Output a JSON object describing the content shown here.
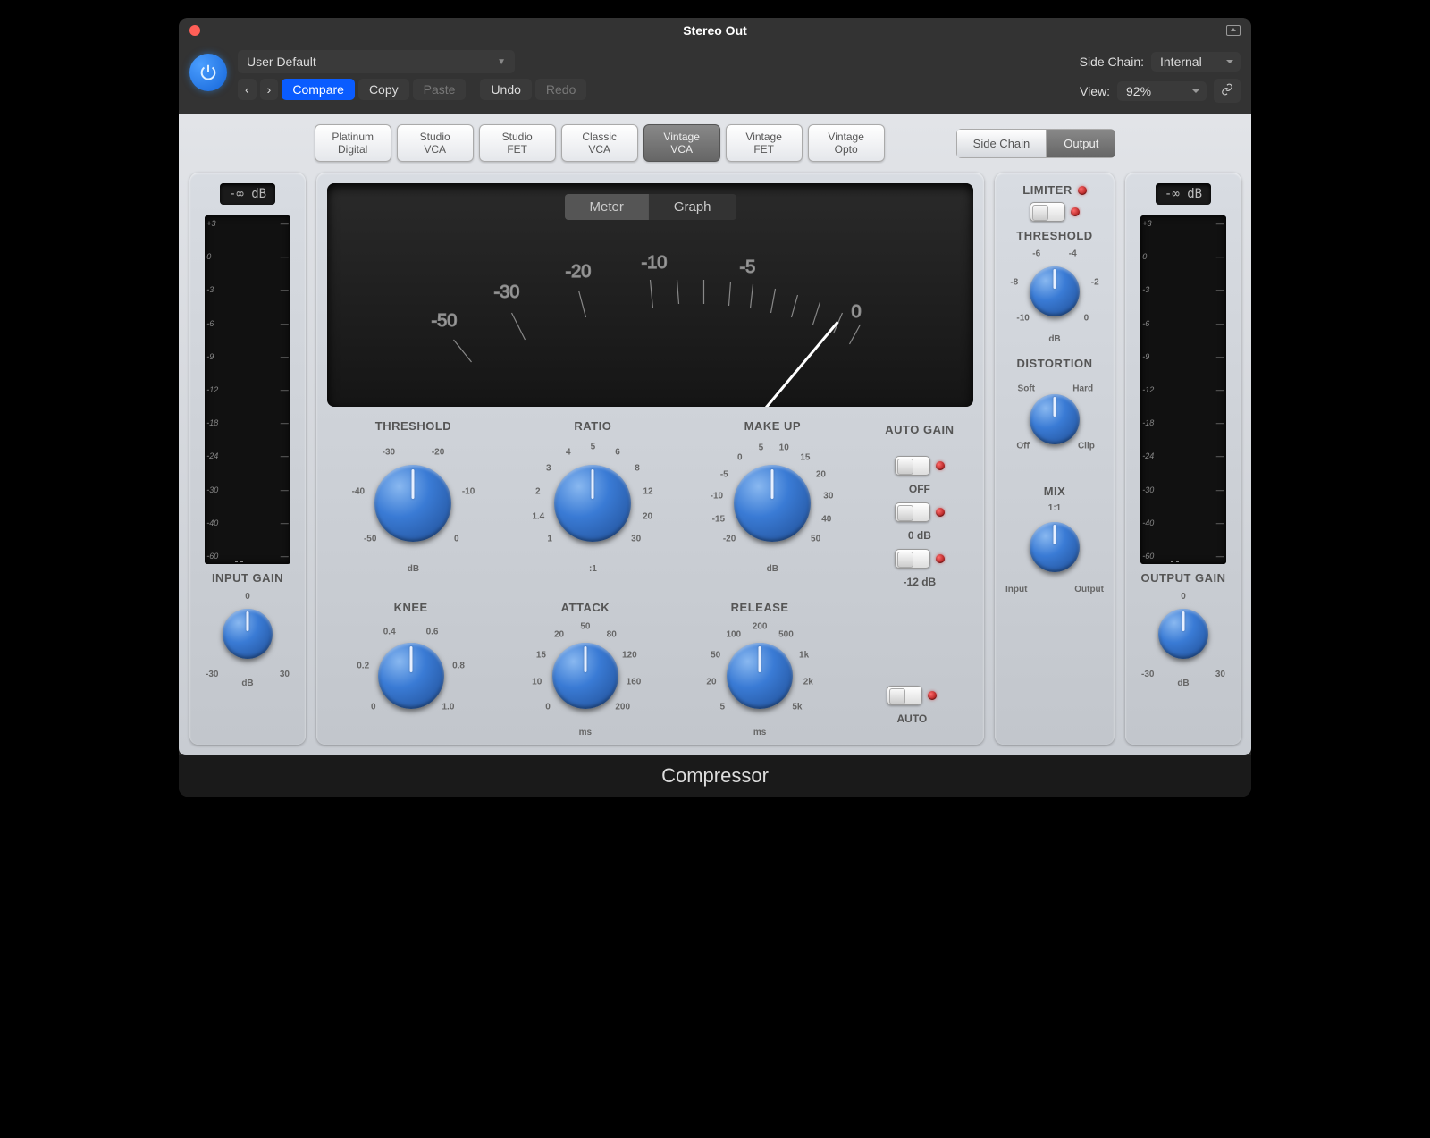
{
  "title": "Stereo Out",
  "preset": "User Default",
  "toolbar": {
    "compare": "Compare",
    "copy": "Copy",
    "paste": "Paste",
    "undo": "Undo",
    "redo": "Redo",
    "sidechain_label": "Side Chain:",
    "sidechain_value": "Internal",
    "view_label": "View:",
    "view_value": "92%"
  },
  "models": [
    {
      "l1": "Platinum",
      "l2": "Digital"
    },
    {
      "l1": "Studio",
      "l2": "VCA"
    },
    {
      "l1": "Studio",
      "l2": "FET"
    },
    {
      "l1": "Classic",
      "l2": "VCA"
    },
    {
      "l1": "Vintage",
      "l2": "VCA",
      "active": true
    },
    {
      "l1": "Vintage",
      "l2": "FET"
    },
    {
      "l1": "Vintage",
      "l2": "Opto"
    }
  ],
  "mode_toggle": {
    "sidechain": "Side Chain",
    "output": "Output"
  },
  "meter_toggle": {
    "meter": "Meter",
    "graph": "Graph"
  },
  "input": {
    "lcd": "-∞ dB",
    "label": "INPUT GAIN",
    "ticks": [
      "+3",
      "0",
      "-3",
      "-6",
      "-9",
      "-12",
      "-18",
      "-24",
      "-30",
      "-40",
      "-60"
    ],
    "knob": {
      "center": "0",
      "left": "-30",
      "right": "30",
      "unit": "dB",
      "angle": 0
    }
  },
  "output": {
    "lcd": "-∞ dB",
    "label": "OUTPUT GAIN",
    "ticks": [
      "+3",
      "0",
      "-3",
      "-6",
      "-9",
      "-12",
      "-18",
      "-24",
      "-30",
      "-40",
      "-60"
    ],
    "knob": {
      "center": "0",
      "left": "-30",
      "right": "30",
      "unit": "dB",
      "angle": 0
    }
  },
  "vu_scale": [
    "-50",
    "-30",
    "-20",
    "-10",
    "-5",
    "0"
  ],
  "knobs": {
    "threshold": {
      "label": "THRESHOLD",
      "labels": [
        "-50",
        "-40",
        "-30",
        "-20",
        "-10",
        "0"
      ],
      "unit": "dB",
      "angle": -50
    },
    "ratio": {
      "label": "RATIO",
      "labels": [
        "1",
        "1.4",
        "2",
        "3",
        "4",
        "5",
        "6",
        "8",
        "12",
        "20",
        "30"
      ],
      "unit": ":1",
      "angle": -90
    },
    "makeup": {
      "label": "MAKE UP",
      "labels": [
        "-20",
        "-15",
        "-10",
        "-5",
        "0",
        "5",
        "10",
        "15",
        "20",
        "30",
        "40",
        "50"
      ],
      "unit": "dB",
      "angle": -30
    },
    "knee": {
      "label": "KNEE",
      "labels": [
        "0",
        "0.2",
        "0.4",
        "0.6",
        "0.8",
        "1.0"
      ],
      "angle": 0
    },
    "attack": {
      "label": "ATTACK",
      "labels": [
        "0",
        "10",
        "15",
        "20",
        "50",
        "80",
        "120",
        "160",
        "200"
      ],
      "unit": "ms",
      "angle": -100
    },
    "release": {
      "label": "RELEASE",
      "labels": [
        "5",
        "20",
        "50",
        "100",
        "200",
        "500",
        "1k",
        "2k",
        "5k"
      ],
      "unit": "ms",
      "angle": -70
    }
  },
  "autogain": {
    "label": "AUTO GAIN",
    "off": "OFF",
    "zero": "0 dB",
    "neg12": "-12 dB",
    "auto": "AUTO"
  },
  "limiter": {
    "label": "LIMITER",
    "threshold": {
      "label": "THRESHOLD",
      "labels": [
        "-10",
        "-8",
        "-6",
        "-4",
        "-2",
        "0"
      ],
      "unit": "dB",
      "angle": 60
    },
    "distortion": {
      "label": "DISTORTION",
      "labels": [
        "Off",
        "Soft",
        "Hard",
        "Clip"
      ],
      "angle": -40
    },
    "mix": {
      "label": "MIX",
      "center": "1:1",
      "left": "Input",
      "right": "Output",
      "angle": 0
    }
  },
  "footer": "Compressor"
}
